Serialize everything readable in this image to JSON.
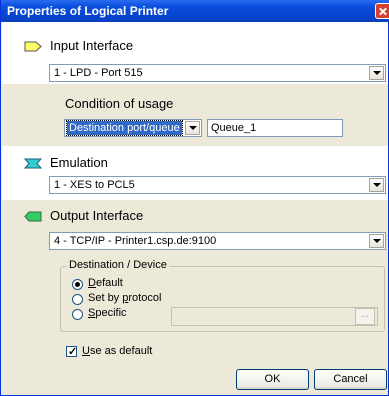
{
  "window": {
    "title": "Properties of Logical Printer"
  },
  "input_interface": {
    "label": "Input Interface",
    "selected": "1 - LPD - Port 515"
  },
  "condition": {
    "label": "Condition of usage",
    "selector_value": "Destination port/queue",
    "queue_value": "Queue_1"
  },
  "emulation": {
    "label": "Emulation",
    "selected": "1 - XES to PCL5"
  },
  "output_interface": {
    "label": "Output Interface",
    "selected": "4 - TCP/IP - Printer1.csp.de:9100"
  },
  "destination": {
    "legend": "Destination / Device",
    "options": [
      {
        "label_pre": "",
        "label_u": "D",
        "label_post": "efault",
        "checked": true
      },
      {
        "label_pre": "Set by ",
        "label_u": "p",
        "label_post": "rotocol",
        "checked": false
      },
      {
        "label_pre": "",
        "label_u": "S",
        "label_post": "pecific",
        "checked": false
      }
    ],
    "browse_label": "..."
  },
  "use_as_default": {
    "label_u": "U",
    "label_post": "se as default",
    "checked": true
  },
  "buttons": {
    "ok": "OK",
    "cancel": "Cancel"
  },
  "icons": {
    "input": "input-interface-icon",
    "emulation": "emulation-icon",
    "output": "output-interface-icon"
  },
  "colors": {
    "titlebar": "#0a4fdc",
    "input_icon": "#ffff66",
    "emulation_icon": "#33cccc",
    "output_icon": "#33cc66"
  }
}
